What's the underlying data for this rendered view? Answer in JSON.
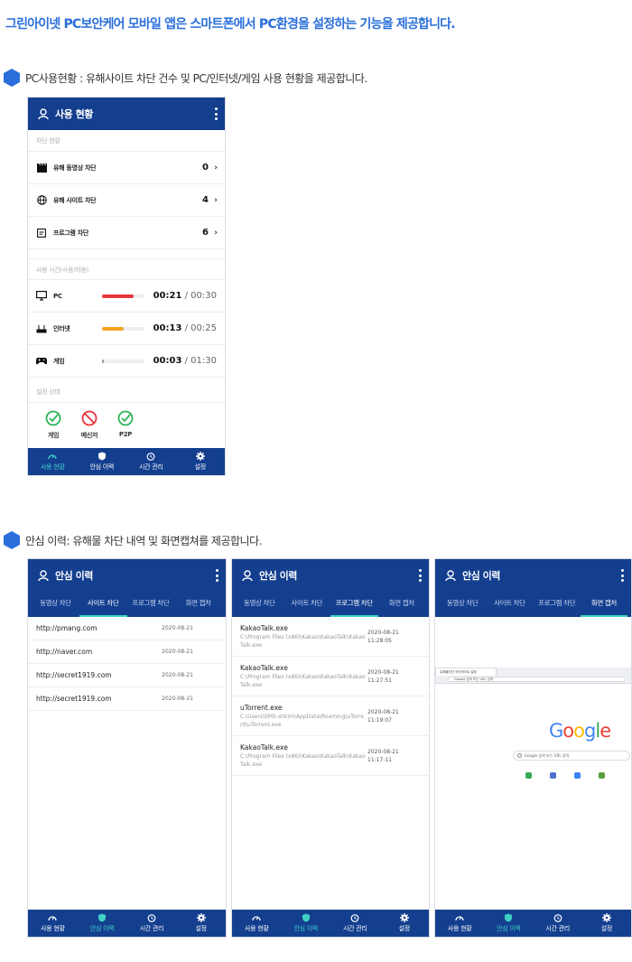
{
  "heading": "그린아이넷 PC보안케어 모바일 앱은 스마트폰에서 PC환경을 설정하는 기능을 제공합니다.",
  "section1_title": "PC사용현황 : 유해사이트 차단 건수 및 PC/인터넷/게임 사용 현황을 제공합니다.",
  "section2_title": "안심 이력: 유해물 차단 내역 및 화면캡쳐를 제공합니다.",
  "usage_screen": {
    "title": "사용 현황",
    "block_section": "차단 현황",
    "block_items": [
      {
        "label": "유해 동영상 차단",
        "count": "0",
        "icon": "film-icon"
      },
      {
        "label": "유해 사이트 차단",
        "count": "4",
        "icon": "globe-icon"
      },
      {
        "label": "프로그램 차단",
        "count": "6",
        "icon": "program-icon"
      }
    ],
    "time_section": "사용 시간(사용/허용)",
    "time_items": [
      {
        "label": "PC",
        "used": "00:21",
        "allowed": "/ 00:30",
        "progress": 0.75,
        "color": "#e8333a",
        "icon": "monitor-icon"
      },
      {
        "label": "인터넷",
        "used": "00:13",
        "allowed": "/ 00:25",
        "progress": 0.52,
        "color": "#f5a021",
        "icon": "router-icon"
      },
      {
        "label": "게임",
        "used": "00:03",
        "allowed": "/ 01:30",
        "progress": 0.04,
        "color": "#999999",
        "icon": "gamepad-icon"
      }
    ],
    "status_section": "설정 상태",
    "status_items": [
      {
        "label": "게임",
        "state": "allowed"
      },
      {
        "label": "메신저",
        "state": "blocked"
      },
      {
        "label": "P2P",
        "state": "allowed"
      }
    ]
  },
  "nav": {
    "items": [
      "사용 현황",
      "안심 이력",
      "시간 관리",
      "설정"
    ]
  },
  "history_screen": {
    "title": "안심 이력",
    "tabs": [
      "동영상 차단",
      "사이트 차단",
      "프로그램 차단",
      "화면 캡처"
    ]
  },
  "site_history": [
    {
      "url": "http://pmang.com",
      "date": "2020-08-21"
    },
    {
      "url": "http://naver.com",
      "date": "2020-08-21"
    },
    {
      "url": "http://secret1919.com",
      "date": "2020-08-21"
    },
    {
      "url": "http://secret1919.com",
      "date": "2020-08-21"
    }
  ],
  "program_history": [
    {
      "name": "KakaoTalk.exe",
      "path": "C:\\Program Files (x86)\\Kakao\\KakaoTalk\\KakaoTalk.exe",
      "date": "2020-08-21",
      "time": "11:28:05"
    },
    {
      "name": "KakaoTalk.exe",
      "path": "C:\\Program Files (x86)\\Kakao\\KakaoTalk\\KakaoTalk.exe",
      "date": "2020-08-21",
      "time": "11:27:51"
    },
    {
      "name": "uTorrent.exe",
      "path": "C:\\Users\\SMS-shkim\\AppData\\Roaming\\uTorrent\\uTorrent.exe",
      "date": "2020-08-21",
      "time": "11:19:07"
    },
    {
      "name": "KakaoTalk.exe",
      "path": "C:\\Program Files (x86)\\Kakao\\KakaoTalk\\KakaoTalk.exe",
      "date": "2020-08-21",
      "time": "11:17:11"
    }
  ],
  "capture": {
    "browser_tab": "유해물차단 보안게이트 설정",
    "address": "Google 검색 또는 URL 입력",
    "logo": "Google",
    "search_placeholder": "Google 검색 또는 URL 입력"
  },
  "colors": {
    "header": "#143f8f",
    "accent": "#3fd1c4",
    "heading": "#2a6fdb",
    "allowed": "#2fb35a",
    "blocked": "#e8333a"
  }
}
